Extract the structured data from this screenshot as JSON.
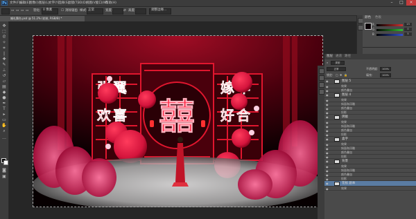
{
  "app": {
    "logo": "Ps"
  },
  "menu": [
    "文件(F)",
    "编辑(E)",
    "图像(I)",
    "图层(L)",
    "文字(Y)",
    "选择(S)",
    "滤镜(T)",
    "3D(D)",
    "视图(V)",
    "窗口(W)",
    "帮助(H)"
  ],
  "window_controls": {
    "minimize": "–",
    "maximize": "□",
    "close": "×"
  },
  "options_bar": {
    "feather_label": "羽化:",
    "feather_value": "0 像素",
    "antialias_label": "消除锯齿",
    "style_label": "样式:",
    "style_value": "正常",
    "width_label": "宽度:",
    "height_label": "高度:",
    "refine_button": "调整边缘..."
  },
  "document_tab": {
    "title": "婚礼舞台.psd @ 51.2% (花枝, RGB/8) *",
    "close": "×"
  },
  "color_panel": {
    "tabs": [
      "颜色",
      "色板"
    ],
    "channels": [
      {
        "label": "R",
        "value": "13",
        "color": "#d03030"
      },
      {
        "label": "G",
        "value": "0",
        "color": "#30c030"
      },
      {
        "label": "B",
        "value": "5",
        "color": "#3050d0"
      }
    ],
    "foreground": "#0a0005"
  },
  "layers_panel": {
    "tabs": [
      "图层",
      "通道",
      "路径"
    ],
    "kind_label": "类型",
    "blend_mode": "正常",
    "opacity_label": "不透明度:",
    "opacity_value": "100%",
    "lock_label": "锁定:",
    "fill_label": "填充:",
    "fill_value": "100%",
    "rows": [
      {
        "type": "layer",
        "name": "图层 5"
      },
      {
        "type": "fx",
        "name": "效果"
      },
      {
        "type": "fx",
        "name": "颜色叠加"
      },
      {
        "type": "layer",
        "name": "图层 4"
      },
      {
        "type": "fx",
        "name": "效果"
      },
      {
        "type": "fx",
        "name": "斜面和浮雕"
      },
      {
        "type": "fx",
        "name": "颜色叠加"
      },
      {
        "type": "fx",
        "name": "投影"
      },
      {
        "type": "layer",
        "name": "牌匾"
      },
      {
        "type": "fx",
        "name": "效果"
      },
      {
        "type": "fx",
        "name": "斜面和浮雕"
      },
      {
        "type": "fx",
        "name": "颜色叠加"
      },
      {
        "type": "fx",
        "name": "投影"
      },
      {
        "type": "layer",
        "name": "喜字"
      },
      {
        "type": "fx",
        "name": "效果"
      },
      {
        "type": "fx",
        "name": "斜面和浮雕"
      },
      {
        "type": "fx",
        "name": "颜色叠加"
      },
      {
        "type": "fx",
        "name": "投影"
      },
      {
        "type": "layer",
        "name": "背景"
      },
      {
        "type": "fx",
        "name": "效果"
      },
      {
        "type": "fx",
        "name": "斜面和浮雕"
      },
      {
        "type": "fx",
        "name": "颜色叠加"
      },
      {
        "type": "fx",
        "name": "投影"
      },
      {
        "type": "layer",
        "name": "花枝 副本",
        "selected": true
      },
      {
        "type": "fx",
        "name": "效果"
      }
    ]
  },
  "canvas": {
    "chars_left": [
      "张",
      "翼",
      "欢",
      "喜"
    ],
    "chars_right": [
      "嫁",
      "年",
      "好",
      "合"
    ],
    "center_char": "囍"
  }
}
